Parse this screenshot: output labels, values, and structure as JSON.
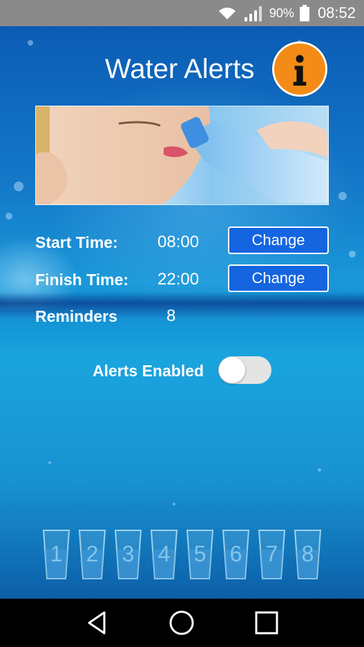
{
  "status_bar": {
    "battery_percent": "90%",
    "time": "08:52",
    "icons": [
      "wifi-icon",
      "signal-icon",
      "battery-icon"
    ]
  },
  "header": {
    "title": "Water Alerts",
    "info_icon": "info-icon",
    "info_color": "#f28c16"
  },
  "settings": {
    "start": {
      "label": "Start Time:",
      "value": "08:00",
      "button": "Change"
    },
    "finish": {
      "label": "Finish Time:",
      "value": "22:00",
      "button": "Change"
    },
    "reminders": {
      "label": "Reminders",
      "value": "8"
    }
  },
  "alerts": {
    "label": "Alerts Enabled",
    "enabled": false
  },
  "glasses": [
    "1",
    "2",
    "3",
    "4",
    "5",
    "6",
    "7",
    "8"
  ],
  "nav": {
    "icons": [
      "back-icon",
      "home-icon",
      "recents-icon"
    ]
  },
  "colors": {
    "button_bg": "#1565e0",
    "accent_orange": "#f28c16"
  }
}
